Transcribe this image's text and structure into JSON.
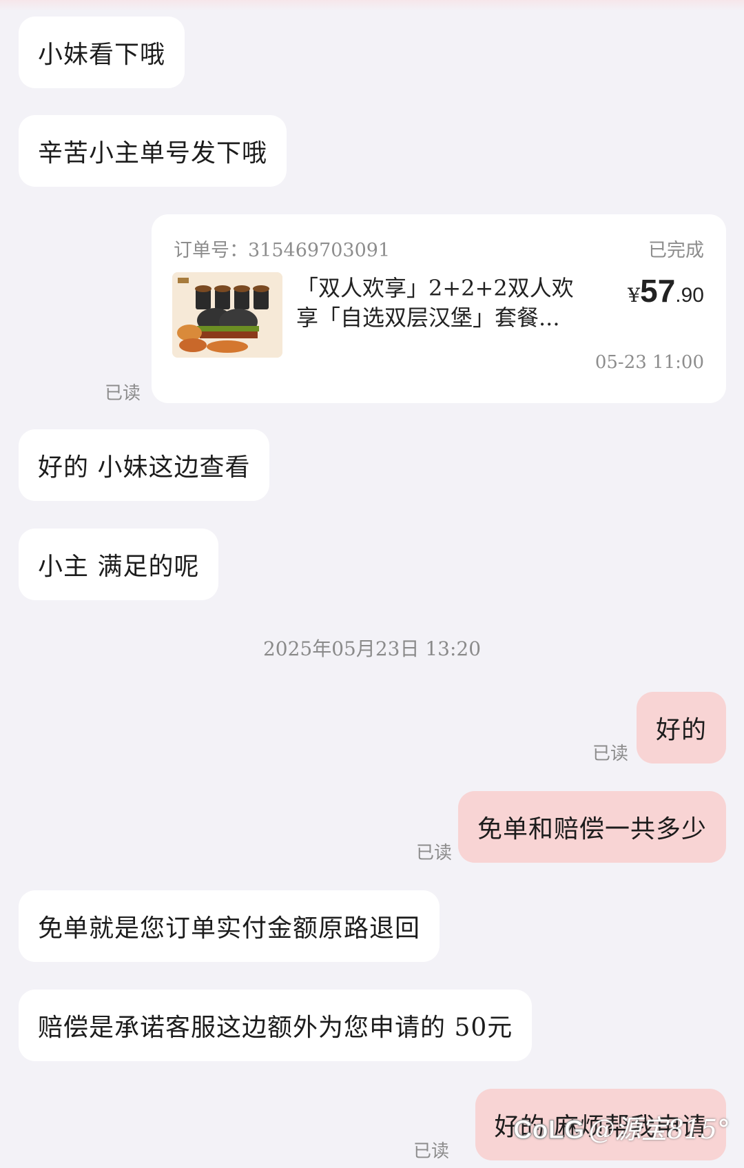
{
  "messages": {
    "m1": "小妹看下哦",
    "m2": "辛苦小主单号发下哦",
    "m3": "好的 小妹这边查看",
    "m4": "小主 满足的呢",
    "m5": "好的",
    "m6": "免单和赔偿一共多少",
    "m7": "免单就是您订单实付金额原路退回",
    "m8": "赔偿是承诺客服这边额外为您申请的 50元",
    "m9": "好的  麻烦帮我申请"
  },
  "read_label": "已读",
  "timestamp": "2025年05月23日  13:20",
  "order": {
    "order_no": "订单号：315469703091",
    "status": "已完成",
    "item_name": "「双人欢享」2+2+2双人欢享「自选双层汉堡」套餐...",
    "price_currency": "¥",
    "price_int": "57",
    "price_dec": ".90",
    "time": "05-23 11:00"
  },
  "watermark": {
    "logo": "CoLG",
    "text": "@源宝815°"
  }
}
